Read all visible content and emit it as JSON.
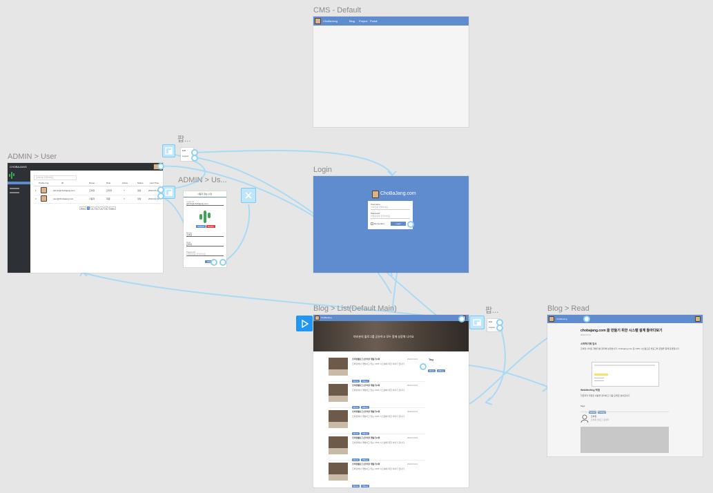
{
  "labels": {
    "cms_default": "CMS - Default",
    "admin_user": "ADMIN > User",
    "popup_1": "팝...",
    "admin_user_edit": "ADMIN > Us...",
    "login": "Login",
    "blog_list": "Blog > List(Default Main)",
    "popup_2": "팝...",
    "blog_read": "Blog > Read"
  },
  "site": {
    "brand": "ChoBaJang",
    "brand_full": "ChoBaJang.com",
    "nav": [
      "Blog",
      "Project",
      "Portal"
    ]
  },
  "admin_user": {
    "brand": "CHOBAJANG",
    "search_placeholder": "검색어를 입력하세요",
    "columns": [
      "Profile Img",
      "ID",
      "Name",
      "Role",
      "Active",
      "Status",
      "Last Time"
    ],
    "rows": [
      {
        "no": "1",
        "id": "admin@chobajang.com",
        "name": "조바장",
        "role": "관리자",
        "active": "Y",
        "status": "정상",
        "time": "2022-04-01"
      },
      {
        "no": "2",
        "id": "user@chobajang.com",
        "name": "사용자",
        "role": "회원",
        "active": "Y",
        "status": "정상",
        "time": "2022-04-01"
      }
    ],
    "pager": [
      "Prev",
      "1",
      "2",
      "3",
      "4",
      "5",
      "Next"
    ]
  },
  "admin_user_edit": {
    "title": "사용자 정보 수정",
    "fields": [
      {
        "label": "Login Id",
        "value": "admin@chobajang.com"
      },
      {
        "label": "Name",
        "value": "조바장"
      },
      {
        "label": "Role",
        "value": "관리자"
      },
      {
        "label": "Password",
        "value": "비밀번호를 입력하세요"
      }
    ],
    "upload_label": "Upload",
    "delete_label": "Delete",
    "save_label": "Save"
  },
  "login": {
    "username_label": "Username",
    "username_placeholder": "아이디를 입력하세요",
    "password_label": "Password",
    "password_placeholder": "비밀번호를 입력하세요",
    "remember_label": "Remember",
    "login_button": "Login"
  },
  "blog_list": {
    "hero_text": "여러분의 블로그를 공유하고 모두 함께 성장해 나가요",
    "tag_heading": "Tag",
    "tags": [
      "#cms",
      "#blog"
    ],
    "posts": [
      {
        "title": "조바장블로그(조바장 개발기)1화",
        "date": "2022.04.01",
        "excerpt": "조바장에서 개발하고 있는 CMS 시스템에 대한 이야기 입니다.",
        "tags": [
          "#cms",
          "#blog"
        ]
      },
      {
        "title": "조바장블로그(조바장 개발기)1화",
        "date": "2022.04.01",
        "excerpt": "조바장에서 개발하고 있는 CMS 시스템에 대한 이야기 입니다.",
        "tags": [
          "#cms",
          "#blog"
        ]
      },
      {
        "title": "조바장블로그(조바장 개발기)1화",
        "date": "2022.04.01",
        "excerpt": "조바장에서 개발하고 있는 CMS 시스템에 대한 이야기 입니다.",
        "tags": [
          "#cms",
          "#blog"
        ]
      },
      {
        "title": "조바장블로그(조바장 개발기)1화",
        "date": "2022.04.01",
        "excerpt": "조바장에서 개발하고 있는 CMS 시스템에 대한 이야기 입니다.",
        "tags": [
          "#cms",
          "#blog"
        ]
      },
      {
        "title": "조바장블로그(조바장 개발기)1화",
        "date": "2022.04.01",
        "excerpt": "조바장에서 개발하고 있는 CMS 시스템에 대한 이야기 입니다.",
        "tags": [
          "#cms",
          "#blog"
        ]
      }
    ]
  },
  "popup": {
    "items": [
      "Edit",
      "Logout"
    ]
  },
  "blog_read": {
    "title": "chobajang.com 을 만들기 위한 시스템 설계 돌아다보기",
    "date": "2022.04.01",
    "section_heading": "시작하기에 앞서",
    "body": "조바장 사이트 개발기를 정리해 보았습니다. chobajang.com 은 CMS 시스템으로 블로그와 포털을 함께 운영합니다.",
    "section_heading_2": "WebMeeting 작업",
    "body_2": "지금까지 작업한 내용을 정리하고 다음 단계로 넘어갑니다.",
    "tags_label": "Tags",
    "tags": [
      "#cms",
      "#blog"
    ],
    "author": "조바장",
    "author_sub": "조바장 블로그 운영자"
  },
  "colors": {
    "canvas": "#e6e6e6",
    "brand_blue": "#5f8ccf",
    "admin_dark": "#2d3035",
    "hotspot": "#bfe6fb",
    "link": "#8fd0f4"
  }
}
